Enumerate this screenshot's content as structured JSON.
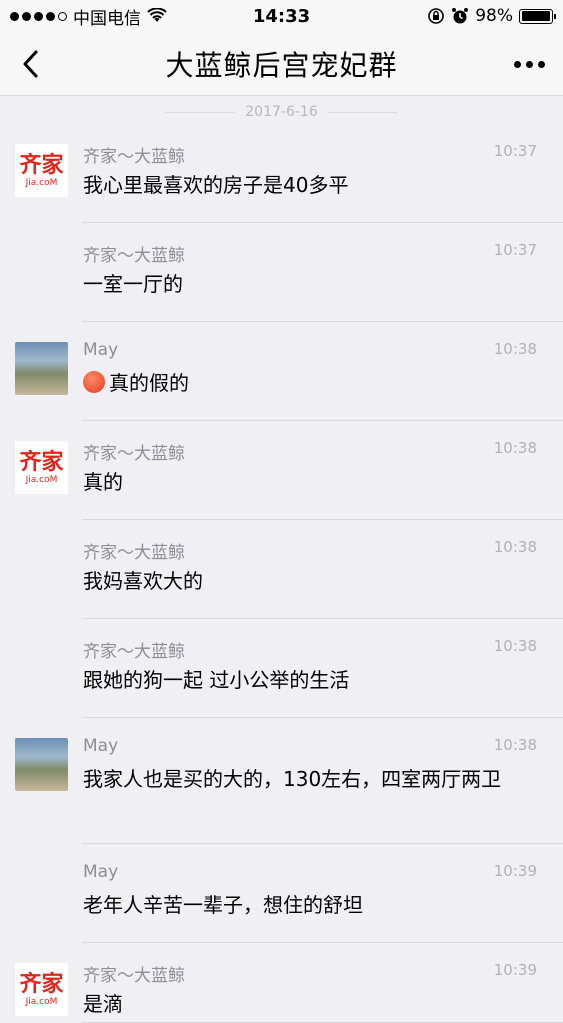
{
  "status_bar": {
    "carrier": "中国电信",
    "time": "14:33",
    "battery": "98%",
    "battery_level": 0.98
  },
  "nav": {
    "title": "大蓝鲸后宫宠妃群"
  },
  "date_separator": "2017-6-16",
  "messages": [
    {
      "sender": "齐家～大蓝鲸",
      "time": "10:37",
      "text": "我心里最喜欢的房子是40多平",
      "avatar": "jia"
    },
    {
      "sender": "齐家～大蓝鲸",
      "time": "10:37",
      "text": "一室一厅的",
      "avatar": ""
    },
    {
      "sender": "May",
      "time": "10:38",
      "text": "真的假的",
      "avatar": "may",
      "emoji": "angry-face-icon"
    },
    {
      "sender": "齐家～大蓝鲸",
      "time": "10:38",
      "text": "真的",
      "avatar": "jia"
    },
    {
      "sender": "齐家～大蓝鲸",
      "time": "10:38",
      "text": "我妈喜欢大的",
      "avatar": ""
    },
    {
      "sender": "齐家～大蓝鲸",
      "time": "10:38",
      "text": "跟她的狗一起 过小公举的生活",
      "avatar": ""
    },
    {
      "sender": "May",
      "time": "10:38",
      "text": "我家人也是买的大的，130左右，四室两厅两卫",
      "avatar": "may"
    },
    {
      "sender": "May",
      "time": "10:39",
      "text": "老年人辛苦一辈子，想住的舒坦",
      "avatar": ""
    },
    {
      "sender": "齐家～大蓝鲸",
      "time": "10:39",
      "text": "是滴",
      "avatar": "jia"
    }
  ],
  "logo": {
    "line1": "齐家",
    "line2": "Jia.coM"
  },
  "colors": {
    "logo_red": "#e1251b",
    "meta_gray": "#8e8e93",
    "background": "#efeff4"
  }
}
